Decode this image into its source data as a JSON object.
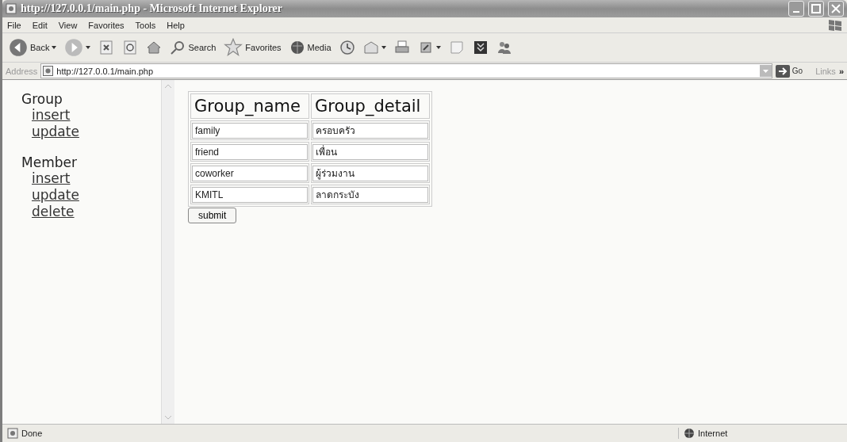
{
  "window": {
    "title": "http://127.0.0.1/main.php - Microsoft Internet Explorer",
    "controls": [
      {
        "kind": "minimize"
      },
      {
        "kind": "maximize"
      },
      {
        "kind": "close"
      }
    ]
  },
  "menu": [
    "File",
    "Edit",
    "View",
    "Favorites",
    "Tools",
    "Help"
  ],
  "toolbar": [
    {
      "kind": "back",
      "label": "Back",
      "dropdown": true
    },
    {
      "kind": "forward",
      "dropdown": true
    },
    {
      "kind": "stop",
      "dropdown": false
    },
    {
      "kind": "refresh",
      "dropdown": false
    },
    {
      "kind": "home",
      "dropdown": false
    },
    {
      "kind": "search",
      "label": "Search",
      "dropdown": false
    },
    {
      "kind": "favorites",
      "label": "Favorites",
      "dropdown": false
    },
    {
      "kind": "media",
      "label": "Media",
      "dropdown": false
    },
    {
      "kind": "history",
      "dropdown": false
    },
    {
      "kind": "mail",
      "dropdown": true
    },
    {
      "kind": "print",
      "dropdown": false
    },
    {
      "kind": "edit",
      "dropdown": true
    },
    {
      "kind": "discuss",
      "dropdown": false
    },
    {
      "kind": "research",
      "dropdown": false
    },
    {
      "kind": "messenger",
      "dropdown": false
    }
  ],
  "address": {
    "label": "Address",
    "value": "http://127.0.0.1/main.php",
    "go": "Go",
    "links": "Links",
    "more": "»"
  },
  "sidebar": [
    {
      "heading": "Group",
      "links": [
        "insert",
        "update"
      ]
    },
    {
      "heading": "Member",
      "links": [
        "insert",
        "update",
        "delete"
      ]
    }
  ],
  "table": {
    "columns": [
      "Group_name",
      "Group_detail"
    ],
    "rows": [
      [
        "family",
        "ครอบครัว"
      ],
      [
        "friend",
        "เพื่อน"
      ],
      [
        "coworker",
        "ผู้ร่วมงาน"
      ],
      [
        "KMITL",
        "ลาดกระบัง"
      ]
    ]
  },
  "submit": "submit",
  "status_bar": {
    "text": "Done",
    "zone": "Internet"
  }
}
